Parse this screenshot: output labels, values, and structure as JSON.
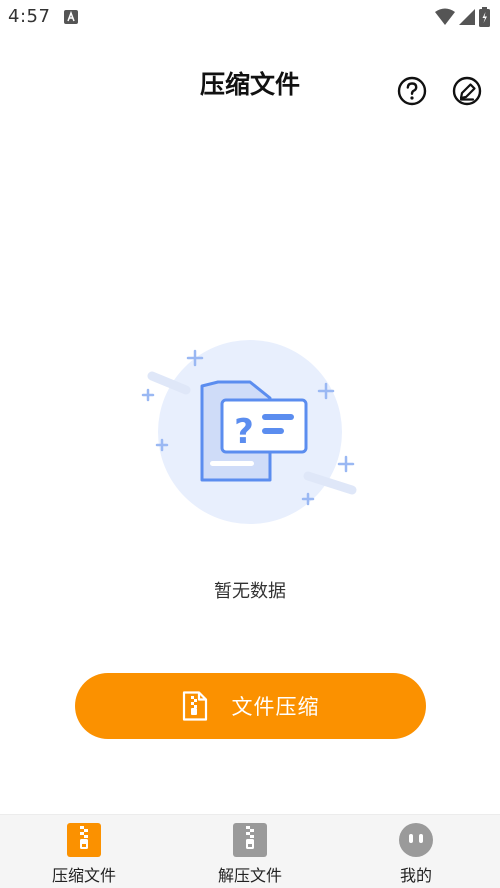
{
  "status_bar": {
    "time": "4:57"
  },
  "header": {
    "title": "压缩文件"
  },
  "empty_state": {
    "message": "暂无数据"
  },
  "primary_action": {
    "label": "文件压缩"
  },
  "bottom_nav": {
    "items": [
      {
        "label": "压缩文件",
        "icon": "zip-file-icon",
        "active": true
      },
      {
        "label": "解压文件",
        "icon": "unzip-file-icon",
        "active": false
      },
      {
        "label": "我的",
        "icon": "profile-face-icon",
        "active": false
      }
    ]
  },
  "colors": {
    "accent": "#fb9100",
    "illustration_blue": "#5b8def",
    "illustration_bg": "#e8effd"
  }
}
